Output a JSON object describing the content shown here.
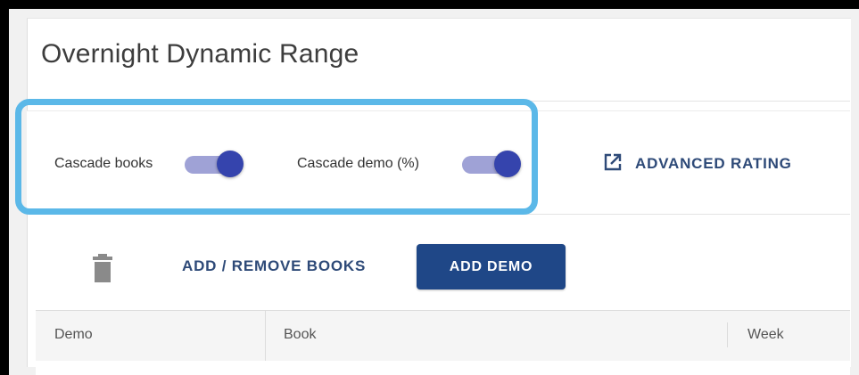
{
  "page": {
    "title": "Overnight Dynamic Range"
  },
  "toggles": [
    {
      "label": "Cascade books",
      "checked": true
    },
    {
      "label": "Cascade demo (%)",
      "checked": true
    }
  ],
  "toolbar": {
    "advanced_rating_label": "ADVANCED RATING",
    "advanced_rating_icon": "open-in-new-icon"
  },
  "actions": {
    "delete_icon": "trash-icon",
    "add_remove_books_label": "ADD / REMOVE BOOKS",
    "add_demo_label": "ADD DEMO"
  },
  "table": {
    "columns": [
      "Demo",
      "Book",
      "Week"
    ]
  },
  "colors": {
    "highlight": "#5bb8e8",
    "primary": "#1f4787",
    "link": "#2e4a78",
    "switch_thumb": "#3544ad",
    "switch_track": "#9fa2d6"
  }
}
